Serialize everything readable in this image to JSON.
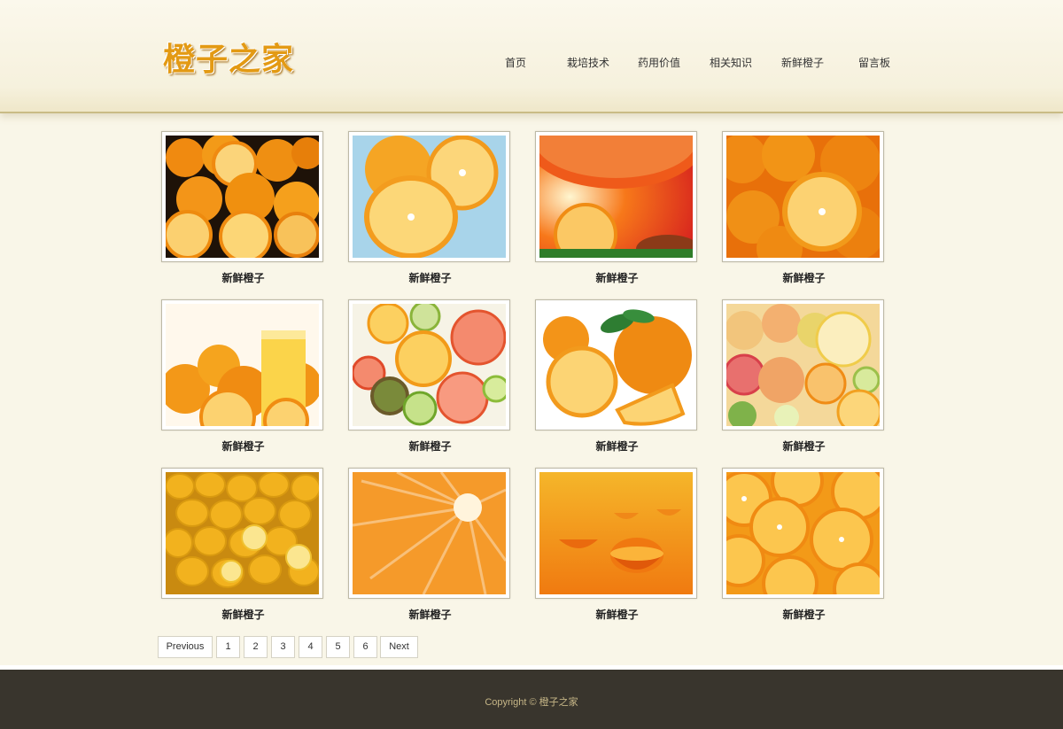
{
  "site": {
    "logo_text": "橙子之家"
  },
  "nav": [
    {
      "label": "首页"
    },
    {
      "label": "栽培技术"
    },
    {
      "label": "药用价值"
    },
    {
      "label": "相关知识"
    },
    {
      "label": "新鲜橙子"
    },
    {
      "label": "留言板"
    }
  ],
  "gallery": [
    {
      "caption": "新鲜橙子",
      "image": "oranges-in-bowl"
    },
    {
      "caption": "新鲜橙子",
      "image": "halved-orange-blue"
    },
    {
      "caption": "新鲜橙子",
      "image": "orange-slice-red"
    },
    {
      "caption": "新鲜橙子",
      "image": "orange-pile-slice"
    },
    {
      "caption": "新鲜橙子",
      "image": "orange-juice-glass"
    },
    {
      "caption": "新鲜橙子",
      "image": "citrus-slices-mix"
    },
    {
      "caption": "新鲜橙子",
      "image": "orange-with-leaves"
    },
    {
      "caption": "新鲜橙子",
      "image": "citrus-assortment"
    },
    {
      "caption": "新鲜橙子",
      "image": "lemon-pile"
    },
    {
      "caption": "新鲜橙子",
      "image": "orange-flesh-closeup"
    },
    {
      "caption": "新鲜橙子",
      "image": "orange-wedges-gradient"
    },
    {
      "caption": "新鲜橙子",
      "image": "orange-slices-tiled"
    }
  ],
  "pagination": {
    "previous": "Previous",
    "pages": [
      "1",
      "2",
      "3",
      "4",
      "5",
      "6"
    ],
    "next": "Next"
  },
  "footer": {
    "copyright": "Copyright © 橙子之家"
  },
  "colors": {
    "background": "#f9f6e8",
    "footer_bg": "#39352d",
    "footer_text": "#c6b687",
    "logo": "#e39a14",
    "orange": "#f29111"
  }
}
